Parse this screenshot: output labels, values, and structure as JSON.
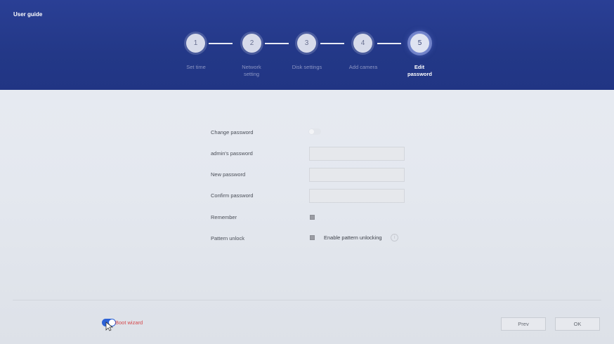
{
  "header": {
    "title": "User guide"
  },
  "steps": [
    {
      "number": "1",
      "label": "Set time"
    },
    {
      "number": "2",
      "label": "Network setting"
    },
    {
      "number": "3",
      "label": "Disk settings"
    },
    {
      "number": "4",
      "label": "Add camera"
    },
    {
      "number": "5",
      "label": "Edit password",
      "active": true
    }
  ],
  "form": {
    "change_password_label": "Change password",
    "change_password_enabled": false,
    "admin_password_label": "admin's password",
    "admin_password_value": "",
    "new_password_label": "New password",
    "new_password_value": "",
    "confirm_password_label": "Confirm password",
    "confirm_password_value": "",
    "remember_label": "Remember",
    "pattern_unlock_label": "Pattern unlock",
    "enable_pattern_label": "Enable pattern unlocking",
    "info_icon": "info-icon"
  },
  "footer": {
    "boot_wizard_label": "Boot wizard",
    "boot_wizard_enabled": true,
    "prev_label": "Prev",
    "ok_label": "OK"
  },
  "colors": {
    "header_bg": "#233887",
    "accent": "#2d62d6",
    "boot_wizard_text": "#d5484b"
  }
}
